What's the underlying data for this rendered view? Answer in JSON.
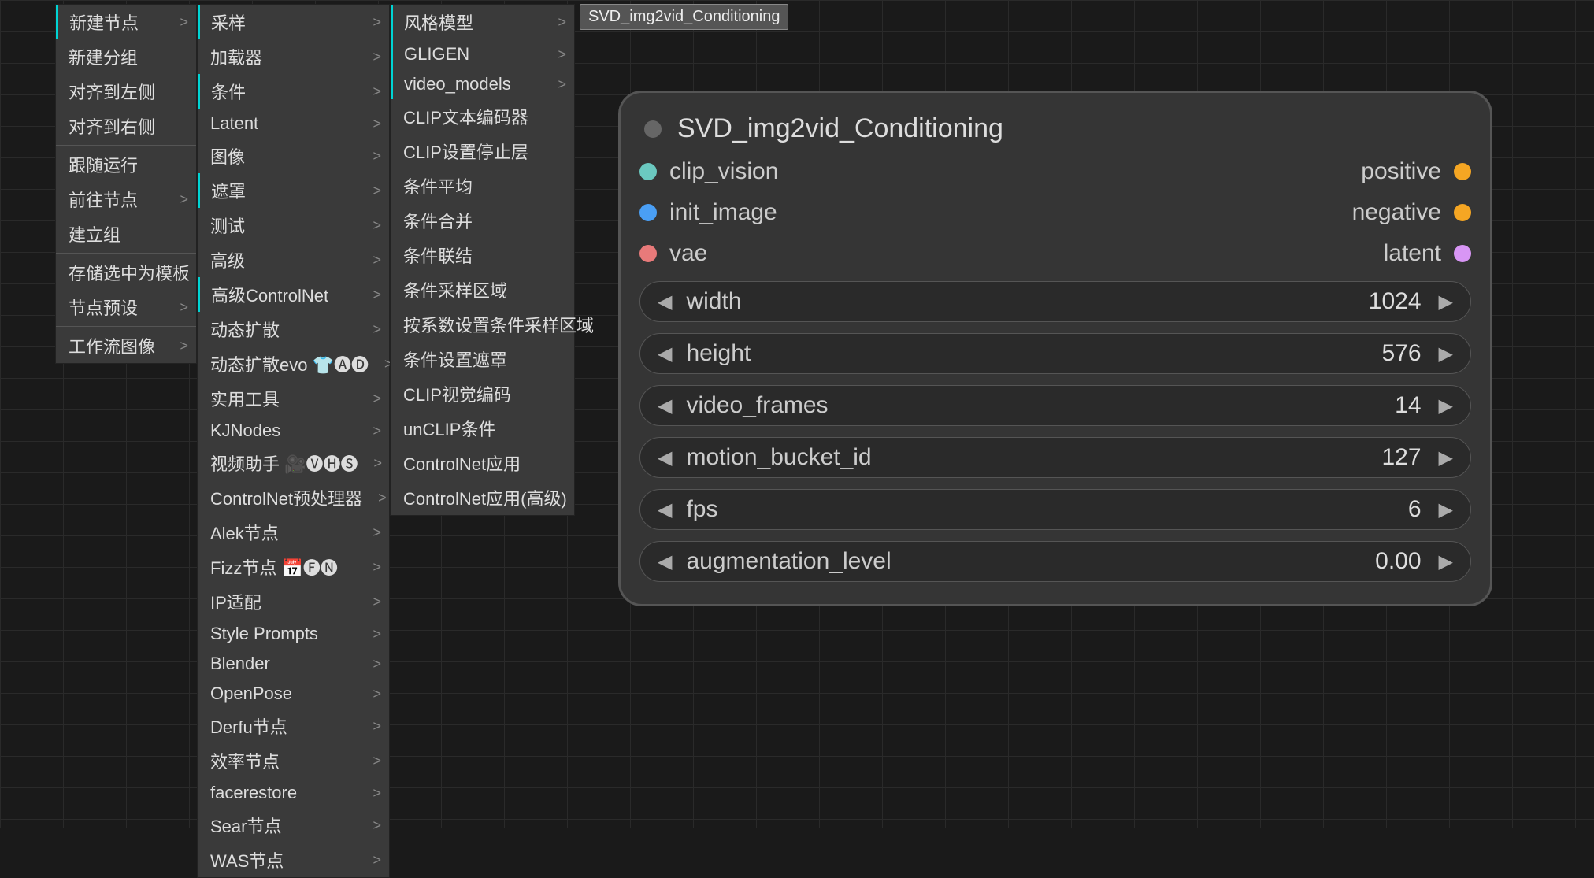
{
  "menus": {
    "col1": [
      {
        "label": "新建节点",
        "arrow": true,
        "sep": false,
        "hl": true
      },
      {
        "label": "新建分组",
        "arrow": false,
        "sep": false
      },
      {
        "label": "对齐到左侧",
        "arrow": false,
        "sep": false
      },
      {
        "label": "对齐到右侧",
        "arrow": false,
        "sep": false
      },
      {
        "label": "",
        "arrow": false,
        "sep": true
      },
      {
        "label": "跟随运行",
        "arrow": false,
        "sep": false
      },
      {
        "label": "前往节点",
        "arrow": true,
        "sep": false
      },
      {
        "label": "建立组",
        "arrow": false,
        "sep": false
      },
      {
        "label": "",
        "arrow": false,
        "sep": true
      },
      {
        "label": "存储选中为模板",
        "arrow": false,
        "sep": false
      },
      {
        "label": "节点预设",
        "arrow": true,
        "sep": false
      },
      {
        "label": "",
        "arrow": false,
        "sep": true
      },
      {
        "label": "工作流图像",
        "arrow": true,
        "sep": false
      }
    ],
    "col2": [
      {
        "label": "采样",
        "arrow": true,
        "hl": true
      },
      {
        "label": "加载器",
        "arrow": true
      },
      {
        "label": "条件",
        "arrow": true,
        "hl": true
      },
      {
        "label": "Latent",
        "arrow": true
      },
      {
        "label": "图像",
        "arrow": true
      },
      {
        "label": "遮罩",
        "arrow": true,
        "hl": true
      },
      {
        "label": "测试",
        "arrow": true
      },
      {
        "label": "高级",
        "arrow": true
      },
      {
        "label": "高级ControlNet",
        "arrow": true,
        "hl": true
      },
      {
        "label": "动态扩散",
        "arrow": true
      },
      {
        "label": "动态扩散evo 👕🅐🅓",
        "arrow": true
      },
      {
        "label": "实用工具",
        "arrow": true
      },
      {
        "label": "KJNodes",
        "arrow": true
      },
      {
        "label": "视频助手 🎥🅥🅗🅢",
        "arrow": true
      },
      {
        "label": "ControlNet预处理器",
        "arrow": true
      },
      {
        "label": "Alek节点",
        "arrow": true
      },
      {
        "label": "Fizz节点 📅🅕🅝",
        "arrow": true
      },
      {
        "label": "IP适配",
        "arrow": true
      },
      {
        "label": "Style Prompts",
        "arrow": true
      },
      {
        "label": "Blender",
        "arrow": true
      },
      {
        "label": "OpenPose",
        "arrow": true
      },
      {
        "label": "Derfu节点",
        "arrow": true
      },
      {
        "label": "效率节点",
        "arrow": true
      },
      {
        "label": "facerestore",
        "arrow": true
      },
      {
        "label": "Sear节点",
        "arrow": true
      },
      {
        "label": "WAS节点",
        "arrow": true
      }
    ],
    "col3": [
      {
        "label": "风格模型",
        "arrow": true,
        "hl": true
      },
      {
        "label": "GLIGEN",
        "arrow": true,
        "hl": true
      },
      {
        "label": "video_models",
        "arrow": true,
        "hl": true
      },
      {
        "label": "CLIP文本编码器",
        "arrow": false
      },
      {
        "label": "CLIP设置停止层",
        "arrow": false
      },
      {
        "label": "条件平均",
        "arrow": false
      },
      {
        "label": "条件合并",
        "arrow": false
      },
      {
        "label": "条件联结",
        "arrow": false
      },
      {
        "label": "条件采样区域",
        "arrow": false
      },
      {
        "label": "按系数设置条件采样区域",
        "arrow": false
      },
      {
        "label": "条件设置遮罩",
        "arrow": false
      },
      {
        "label": "CLIP视觉编码",
        "arrow": false
      },
      {
        "label": "unCLIP条件",
        "arrow": false
      },
      {
        "label": "ControlNet应用",
        "arrow": false
      },
      {
        "label": "ControlNet应用(高级)",
        "arrow": false
      }
    ],
    "final": "SVD_img2vid_Conditioning"
  },
  "node": {
    "title": "SVD_img2vid_Conditioning",
    "inputs": [
      {
        "name": "clip_vision",
        "color": "#6bc9c0"
      },
      {
        "name": "init_image",
        "color": "#4a9ff5"
      },
      {
        "name": "vae",
        "color": "#e87a7a"
      }
    ],
    "outputs": [
      {
        "name": "positive",
        "color": "#f5a623"
      },
      {
        "name": "negative",
        "color": "#f5a623"
      },
      {
        "name": "latent",
        "color": "#d896f5"
      }
    ],
    "widgets": [
      {
        "label": "width",
        "value": "1024"
      },
      {
        "label": "height",
        "value": "576"
      },
      {
        "label": "video_frames",
        "value": "14"
      },
      {
        "label": "motion_bucket_id",
        "value": "127"
      },
      {
        "label": "fps",
        "value": "6"
      },
      {
        "label": "augmentation_level",
        "value": "0.00"
      }
    ]
  }
}
